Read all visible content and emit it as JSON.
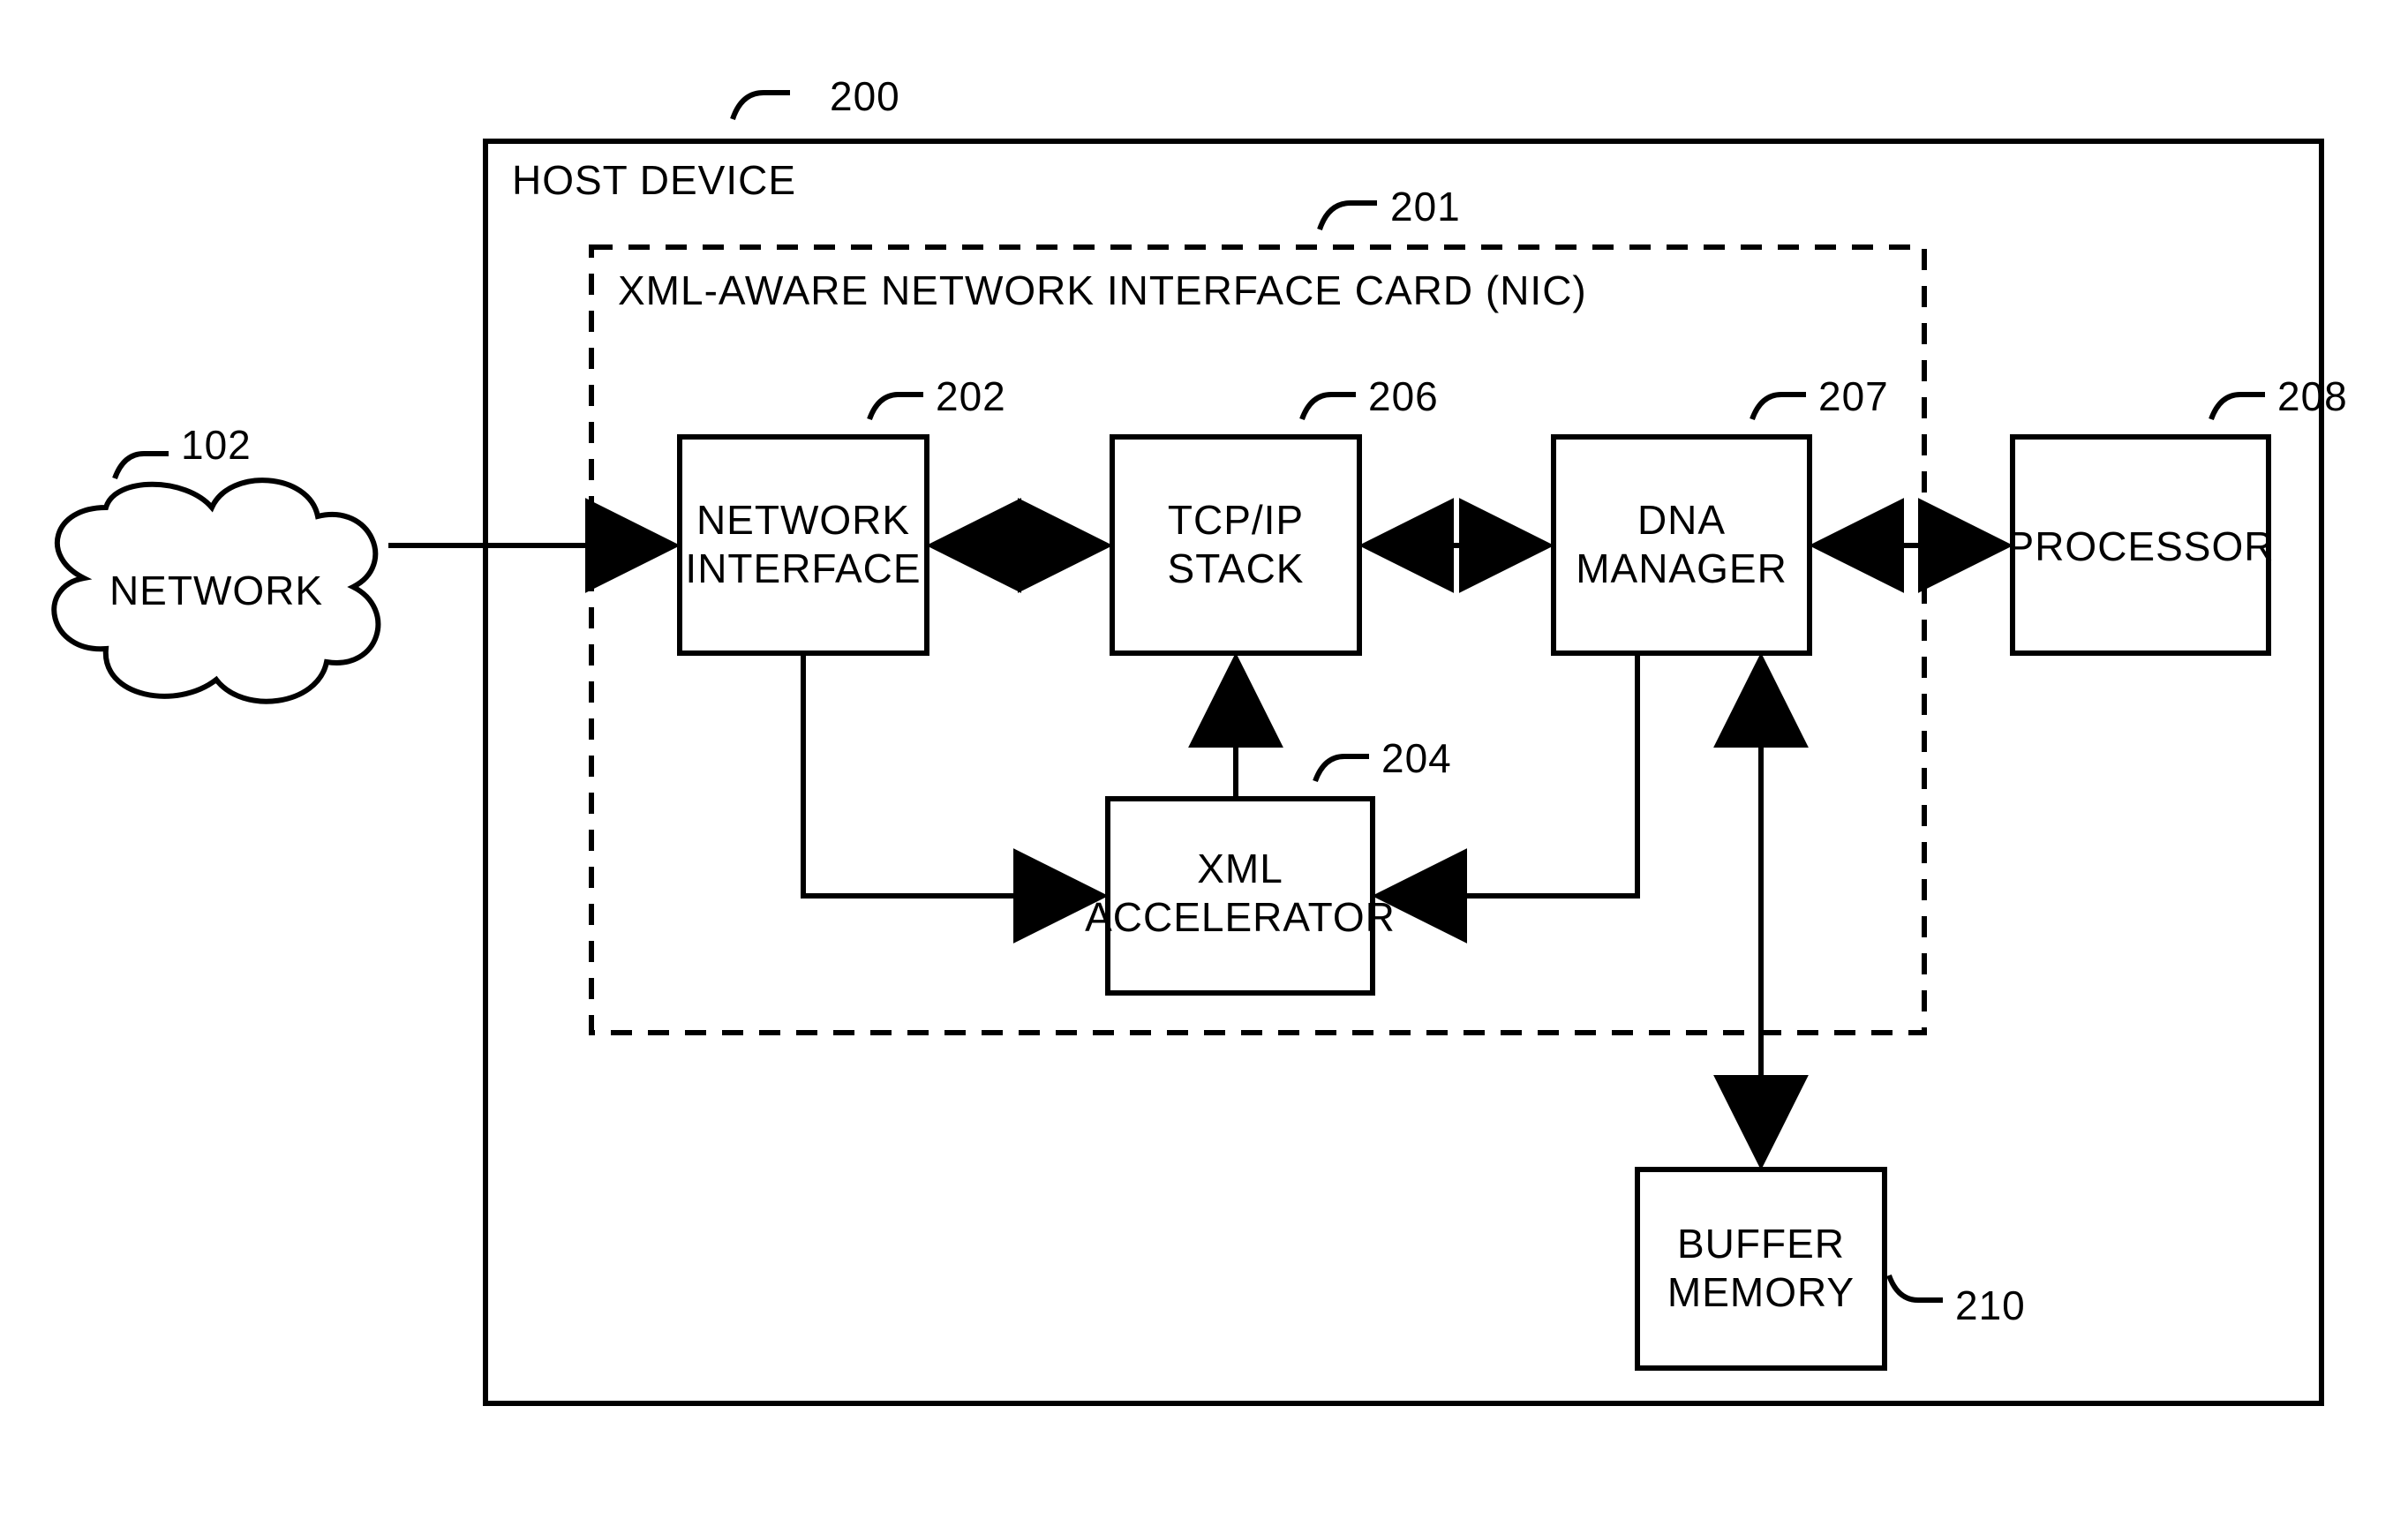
{
  "refs": {
    "network": "102",
    "host": "200",
    "nic": "201",
    "net_if": "202",
    "xml_acc": "204",
    "tcp": "206",
    "dna": "207",
    "proc": "208",
    "buf": "210"
  },
  "labels": {
    "host": "HOST DEVICE",
    "nic": "XML-AWARE NETWORK INTERFACE CARD (NIC)",
    "network": "NETWORK",
    "net_if_1": "NETWORK",
    "net_if_2": "INTERFACE",
    "tcp_1": "TCP/IP",
    "tcp_2": "STACK",
    "dna_1": "DNA",
    "dna_2": "MANAGER",
    "proc": "PROCESSOR",
    "xml_1": "XML",
    "xml_2": "ACCELERATOR",
    "buf_1": "BUFFER",
    "buf_2": "MEMORY"
  }
}
